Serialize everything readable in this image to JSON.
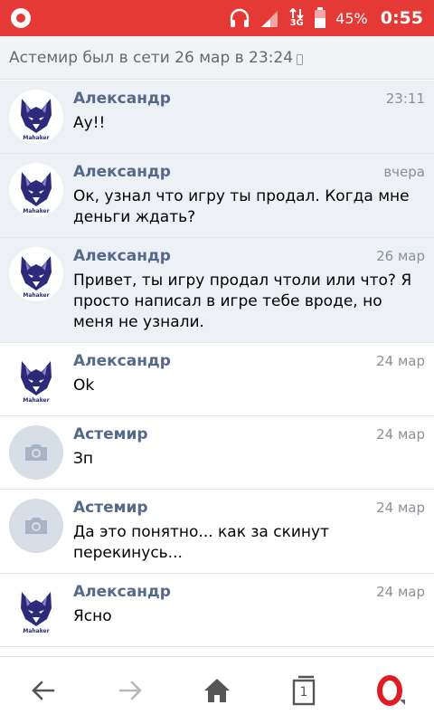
{
  "status_bar": {
    "battery": "45%",
    "network": "3G",
    "time": "0:55"
  },
  "header": {
    "status_text": "Астемир был в сети 26 мар в 23:24"
  },
  "messages": [
    {
      "sender": "Александр",
      "time": "23:11",
      "text": "Ау!!",
      "avatar": "wolf-logo",
      "unread": true
    },
    {
      "sender": "Александр",
      "time": "вчера",
      "text": "Ок, узнал что игру ты продал. Когда мне деньги ждать?",
      "avatar": "wolf-logo",
      "unread": true
    },
    {
      "sender": "Александр",
      "time": "26 мар",
      "text": "Привет, ты игру продал чтоли или что? Я просто написал в игре тебе вроде, но меня не узнали.",
      "avatar": "wolf-logo",
      "unread": true
    },
    {
      "sender": "Александр",
      "time": "24 мар",
      "text": "Ok",
      "avatar": "wolf-logo",
      "unread": false
    },
    {
      "sender": "Астемир",
      "time": "24 мар",
      "text": "Зп",
      "avatar": "camera-placeholder",
      "unread": false
    },
    {
      "sender": "Астемир",
      "time": "24 мар",
      "text": "Да это понятно... как за скинут перекинусь...",
      "avatar": "camera-placeholder",
      "unread": false
    },
    {
      "sender": "Александр",
      "time": "24 мар",
      "text": "Ясно",
      "avatar": "wolf-logo",
      "unread": false
    }
  ],
  "avatar_logo_text": "Mahaker",
  "nav": {
    "tabs_count": "1"
  },
  "colors": {
    "status_bar": "#e53935",
    "sender": "#55698a",
    "unread_bg": "#edf0f5",
    "wolf": "#2e2a7a"
  }
}
